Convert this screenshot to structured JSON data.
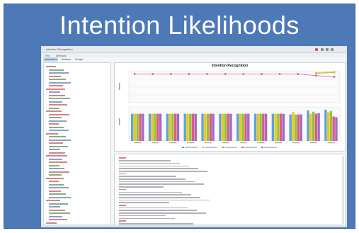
{
  "slide": {
    "title": "Intention Likelihoods",
    "background_color": "#4e79b7"
  },
  "app": {
    "window_title": "Intention Recognition",
    "menu": [
      "File",
      "Window"
    ],
    "tabs": [
      "Intentions",
      "Actions",
      "Graph"
    ],
    "window_buttons_colors": [
      "#d9534f",
      "#8a8f96",
      "#8a8f96",
      "#8a8f96"
    ]
  },
  "sidebar": {
    "line_colors": [
      "#b02020",
      "#207020",
      "#3050a0"
    ],
    "lines_count_hint": "many",
    "lines": []
  },
  "chart_data": {
    "type": "line",
    "title": "Intention Recognition",
    "xlabel": "",
    "ylabel": "",
    "top": {
      "type": "line",
      "steps": 12,
      "series": [
        {
          "color": "#e8558a",
          "values": [
            0.92,
            0.92,
            0.92,
            0.92,
            0.92,
            0.92,
            0.92,
            0.92,
            0.92,
            0.92,
            0.87,
            0.83
          ]
        },
        {
          "color": "#8dc63f",
          "values": [
            null,
            null,
            null,
            null,
            null,
            null,
            null,
            null,
            null,
            null,
            0.94,
            0.97
          ]
        },
        {
          "color": "#f0c419",
          "values": [
            null,
            null,
            null,
            null,
            null,
            null,
            null,
            null,
            null,
            null,
            0.96,
            0.99
          ]
        }
      ],
      "ylim": [
        0,
        1
      ]
    },
    "bottom": {
      "type": "bar",
      "categories": [
        "",
        "",
        "",
        "",
        "",
        "",
        "",
        "",
        "",
        "",
        "",
        ""
      ],
      "series_colors": [
        "#5aa4dc",
        "#f0c419",
        "#8dc63f",
        "#e8558a",
        "#9b6dc6"
      ],
      "values": [
        [
          0.8,
          0.8,
          0.8,
          0.8,
          0.8
        ],
        [
          0.8,
          0.8,
          0.8,
          0.8,
          0.8
        ],
        [
          0.8,
          0.8,
          0.8,
          0.8,
          0.8
        ],
        [
          0.8,
          0.8,
          0.8,
          0.8,
          0.8
        ],
        [
          0.8,
          0.8,
          0.8,
          0.8,
          0.8
        ],
        [
          0.8,
          0.8,
          0.8,
          0.8,
          0.8
        ],
        [
          0.8,
          0.8,
          0.8,
          0.8,
          0.8
        ],
        [
          0.8,
          0.8,
          0.8,
          0.8,
          0.8
        ],
        [
          0.8,
          0.8,
          0.8,
          0.8,
          0.8
        ],
        [
          0.78,
          0.85,
          0.78,
          0.78,
          0.78
        ],
        [
          0.9,
          0.8,
          0.86,
          0.8,
          0.82
        ],
        [
          0.92,
          0.84,
          0.88,
          0.72,
          0.7
        ]
      ],
      "ylim": [
        0,
        1
      ]
    }
  },
  "log": {
    "highlight_color": "#c03030",
    "lines": []
  }
}
